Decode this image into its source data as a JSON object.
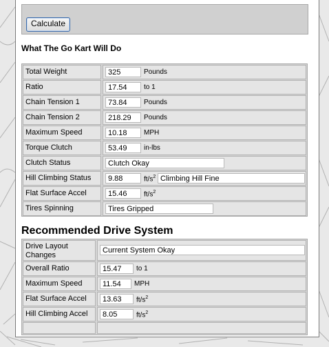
{
  "calc": {
    "button": "Calculate"
  },
  "section1": {
    "title": "What The Go Kart Will Do",
    "rows": [
      {
        "label": "Total Weight",
        "value": "325",
        "unit": "Pounds"
      },
      {
        "label": "Ratio",
        "value": "17.54",
        "unit": "to 1"
      },
      {
        "label": "Chain Tension 1",
        "value": "73.84",
        "unit": "Pounds"
      },
      {
        "label": "Chain Tension 2",
        "value": "218.29",
        "unit": "Pounds"
      },
      {
        "label": "Maximum Speed",
        "value": "10.18",
        "unit": "MPH"
      },
      {
        "label": "Torque Clutch",
        "value": "53.49",
        "unit": "in-lbs"
      },
      {
        "label": "Clutch Status",
        "value": "Clutch Okay",
        "unit": ""
      },
      {
        "label": "Hill Climbing Status",
        "value": "9.88",
        "unit": "ft/s",
        "unit_sup": "2",
        "extra": "Climbing Hill Fine"
      },
      {
        "label": "Flat Surface Accel",
        "value": "15.46",
        "unit": "ft/s",
        "unit_sup": "2"
      },
      {
        "label": "Tires Spinning",
        "value": "Tires Gripped",
        "unit": ""
      }
    ]
  },
  "section2": {
    "title": "Recommended Drive System",
    "rows": [
      {
        "label": "Drive Layout Changes",
        "value": "Current System Okay",
        "unit": ""
      },
      {
        "label": "Overall Ratio",
        "value": "15.47",
        "unit": "to 1"
      },
      {
        "label": "Maximum Speed",
        "value": "11.54",
        "unit": "MPH"
      },
      {
        "label": "Flat Surface Accel",
        "value": "13.63",
        "unit": "ft/s",
        "unit_sup": "2"
      },
      {
        "label": "Hill Climbing Accel",
        "value": "8.05",
        "unit": "ft/s",
        "unit_sup": "2"
      }
    ]
  }
}
